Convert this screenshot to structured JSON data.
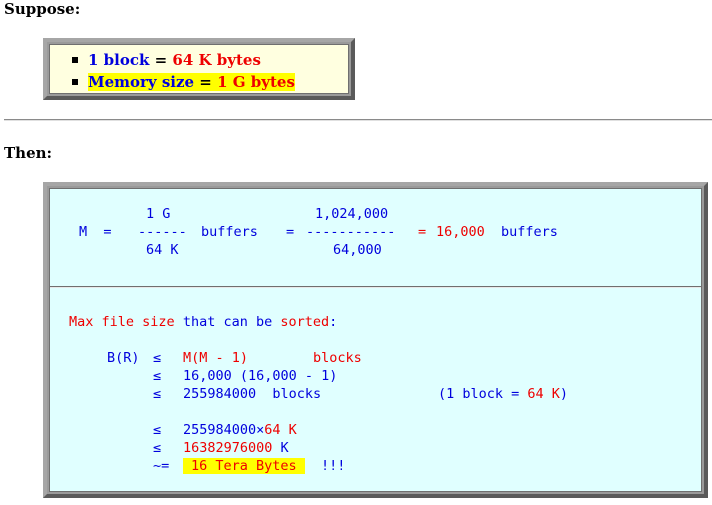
{
  "suppose": {
    "heading": "Suppose:",
    "items": [
      {
        "lhs": "1 block",
        "eq": " = ",
        "rhs": "64 K bytes"
      },
      {
        "lhs": "Memory size",
        "eq": " = ",
        "rhs": "1 G bytes"
      }
    ]
  },
  "then": {
    "heading": "Then:",
    "m_formula": {
      "num1": "1 G",
      "num2": "1,024,000",
      "lhs": "M  =",
      "dash1": "------",
      "unit1": "buffers",
      "eq2": "=",
      "dash2": "-----------",
      "eq3": "=",
      "result": "16,000",
      "unit2": "buffers",
      "den1": "64 K",
      "den2": "64,000"
    },
    "max_file": {
      "intro_a": "Max file size",
      "intro_b": "that can be",
      "intro_c": "sorted",
      "intro_d": ":",
      "br": "B(R)",
      "le": "≤",
      "approx": "~=",
      "l1_expr": "M(M - 1)",
      "l1_unit": "blocks",
      "l2_expr": "16,000 (16,000 - 1)",
      "l3_expr": "255984000  blocks",
      "l3_note_a": "(1 block = ",
      "l3_note_b": "64 K",
      "l3_note_c": ")",
      "l4_a": "255984000×",
      "l4_b": "64 K",
      "l5_a": "16382976000",
      "l5_b": "K",
      "l6_hl": "16 Tera Bytes",
      "l6_tail": "!!!"
    }
  }
}
